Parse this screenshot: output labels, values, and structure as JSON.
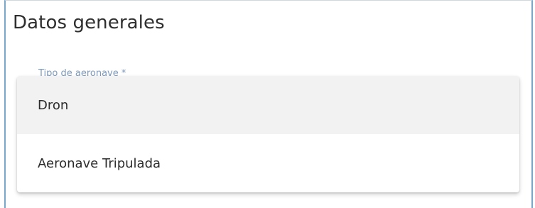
{
  "section": {
    "title": "Datos generales"
  },
  "field": {
    "label": "Tipo de aeronave *"
  },
  "dropdown": {
    "options": [
      {
        "label": "Dron",
        "highlighted": true
      },
      {
        "label": "Aeronave Tripulada",
        "highlighted": false
      }
    ]
  },
  "colors": {
    "panel_border": "#7aa6c9",
    "label_text": "#6f8fb6",
    "highlight_bg": "#f2f2f2"
  }
}
